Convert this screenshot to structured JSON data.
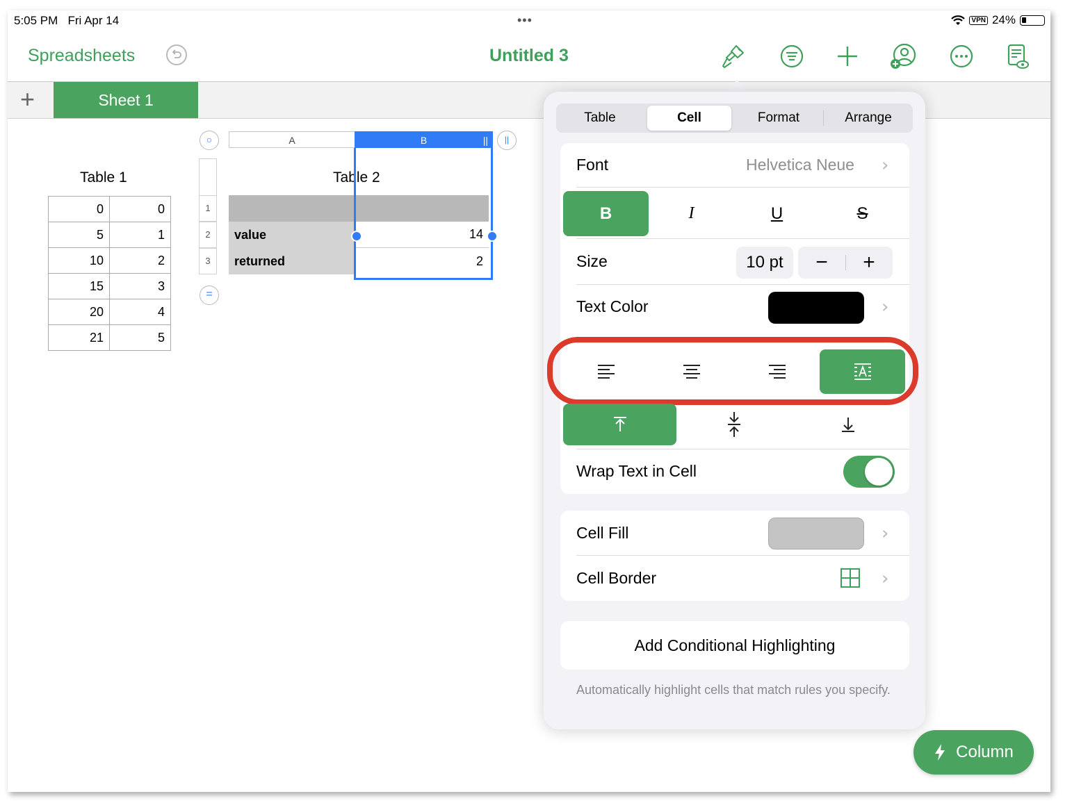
{
  "status": {
    "time": "5:05 PM",
    "date": "Fri Apr 14",
    "dots": "•••",
    "vpn": "VPN",
    "battery": "24%"
  },
  "toolbar": {
    "back_label": "Spreadsheets",
    "title": "Untitled 3"
  },
  "sheets": {
    "add": "+",
    "tabs": [
      {
        "label": "Sheet 1"
      }
    ]
  },
  "table1": {
    "title": "Table 1",
    "rows": [
      [
        "0",
        "0"
      ],
      [
        "5",
        "1"
      ],
      [
        "10",
        "2"
      ],
      [
        "15",
        "3"
      ],
      [
        "20",
        "4"
      ],
      [
        "21",
        "5"
      ]
    ]
  },
  "table2": {
    "title": "Table 2",
    "columns": [
      "A",
      "B"
    ],
    "row_numbers": [
      "1",
      "2",
      "3"
    ],
    "rows": [
      [
        "",
        ""
      ],
      [
        "value",
        "14"
      ],
      [
        "returned",
        "2"
      ]
    ]
  },
  "panel": {
    "tabs": [
      "Table",
      "Cell",
      "Format",
      "Arrange"
    ],
    "selected_tab": "Cell",
    "font": {
      "label": "Font",
      "value": "Helvetica Neue"
    },
    "styles": {
      "bold": "B",
      "italic": "I",
      "underline": "U",
      "strike": "S"
    },
    "size": {
      "label": "Size",
      "value": "10 pt",
      "minus": "−",
      "plus": "+"
    },
    "text_color": {
      "label": "Text Color",
      "color": "#000000"
    },
    "alignment": {
      "selected": "auto"
    },
    "vertical_alignment": {
      "selected": "top"
    },
    "wrap": {
      "label": "Wrap Text in Cell",
      "on": true
    },
    "cell_fill": {
      "label": "Cell Fill",
      "color": "#c4c4c4"
    },
    "cell_border": {
      "label": "Cell Border"
    },
    "conditional": {
      "label": "Add Conditional Highlighting",
      "footnote": "Automatically highlight cells that match rules you specify."
    }
  },
  "column_button": {
    "label": "Column"
  },
  "colors": {
    "accent": "#4aa35f",
    "selection": "#2f7cf6",
    "highlight_ring": "#dc3a2a"
  }
}
